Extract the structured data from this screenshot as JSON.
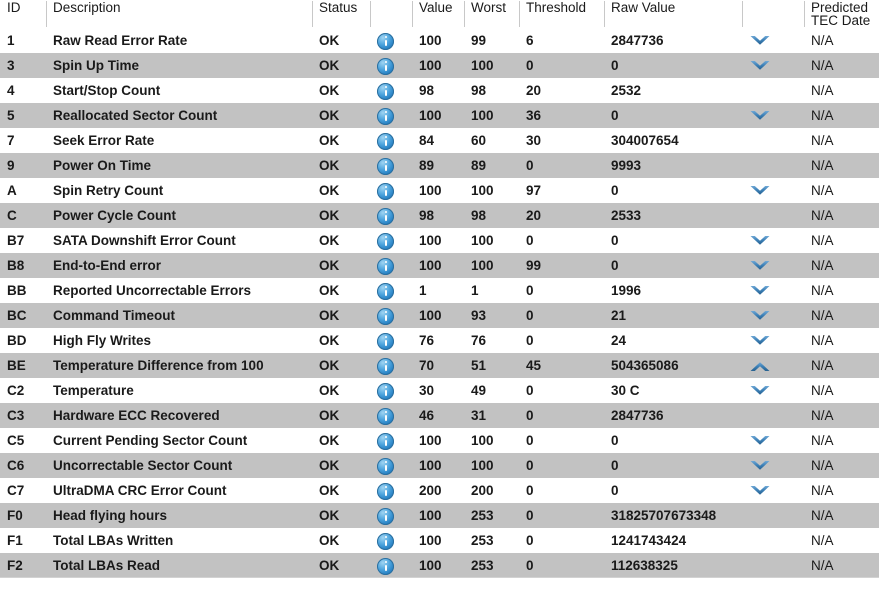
{
  "table": {
    "columns": [
      {
        "key": "id",
        "label": "ID",
        "label2": ""
      },
      {
        "key": "desc",
        "label": "Description",
        "label2": ""
      },
      {
        "key": "status",
        "label": "Status",
        "label2": ""
      },
      {
        "key": "info",
        "label": "",
        "label2": ""
      },
      {
        "key": "value",
        "label": "Value",
        "label2": ""
      },
      {
        "key": "worst",
        "label": "Worst",
        "label2": ""
      },
      {
        "key": "threshold",
        "label": "Threshold",
        "label2": ""
      },
      {
        "key": "raw",
        "label": "Raw Value",
        "label2": ""
      },
      {
        "key": "trend",
        "label": "",
        "label2": ""
      },
      {
        "key": "tec",
        "label": "Predicted",
        "label2": "TEC Date"
      }
    ],
    "icons": {
      "info": "info-icon",
      "trend_down": "chevron-down-icon",
      "trend_up": "chevron-up-icon"
    },
    "colors": {
      "row_even": "#c2c2c2",
      "row_odd": "#ffffff",
      "info_icon_blue": "#1f78bd",
      "chevron_blue": "#2f6fa8",
      "text": "#1a1a1a"
    },
    "rows": [
      {
        "id": "1",
        "desc": "Raw Read Error Rate",
        "status": "OK",
        "value": "100",
        "worst": "99",
        "threshold": "6",
        "raw": "2847736",
        "trend": "down",
        "tec": "N/A"
      },
      {
        "id": "3",
        "desc": "Spin Up Time",
        "status": "OK",
        "value": "100",
        "worst": "100",
        "threshold": "0",
        "raw": "0",
        "trend": "down",
        "tec": "N/A"
      },
      {
        "id": "4",
        "desc": "Start/Stop Count",
        "status": "OK",
        "value": "98",
        "worst": "98",
        "threshold": "20",
        "raw": "2532",
        "trend": "",
        "tec": "N/A"
      },
      {
        "id": "5",
        "desc": "Reallocated Sector Count",
        "status": "OK",
        "value": "100",
        "worst": "100",
        "threshold": "36",
        "raw": "0",
        "trend": "down",
        "tec": "N/A"
      },
      {
        "id": "7",
        "desc": "Seek Error Rate",
        "status": "OK",
        "value": "84",
        "worst": "60",
        "threshold": "30",
        "raw": "304007654",
        "trend": "",
        "tec": "N/A"
      },
      {
        "id": "9",
        "desc": "Power On Time",
        "status": "OK",
        "value": "89",
        "worst": "89",
        "threshold": "0",
        "raw": "9993",
        "trend": "",
        "tec": "N/A"
      },
      {
        "id": "A",
        "desc": "Spin Retry Count",
        "status": "OK",
        "value": "100",
        "worst": "100",
        "threshold": "97",
        "raw": "0",
        "trend": "down",
        "tec": "N/A"
      },
      {
        "id": "C",
        "desc": "Power Cycle Count",
        "status": "OK",
        "value": "98",
        "worst": "98",
        "threshold": "20",
        "raw": "2533",
        "trend": "",
        "tec": "N/A"
      },
      {
        "id": "B7",
        "desc": "SATA Downshift Error Count",
        "status": "OK",
        "value": "100",
        "worst": "100",
        "threshold": "0",
        "raw": "0",
        "trend": "down",
        "tec": "N/A"
      },
      {
        "id": "B8",
        "desc": "End-to-End error",
        "status": "OK",
        "value": "100",
        "worst": "100",
        "threshold": "99",
        "raw": "0",
        "trend": "down",
        "tec": "N/A"
      },
      {
        "id": "BB",
        "desc": "Reported Uncorrectable Errors",
        "status": "OK",
        "value": "1",
        "worst": "1",
        "threshold": "0",
        "raw": "1996",
        "trend": "down",
        "tec": "N/A"
      },
      {
        "id": "BC",
        "desc": "Command Timeout",
        "status": "OK",
        "value": "100",
        "worst": "93",
        "threshold": "0",
        "raw": "21",
        "trend": "down",
        "tec": "N/A"
      },
      {
        "id": "BD",
        "desc": "High Fly Writes",
        "status": "OK",
        "value": "76",
        "worst": "76",
        "threshold": "0",
        "raw": "24",
        "trend": "down",
        "tec": "N/A"
      },
      {
        "id": "BE",
        "desc": "Temperature Difference from 100",
        "status": "OK",
        "value": "70",
        "worst": "51",
        "threshold": "45",
        "raw": "504365086",
        "trend": "up",
        "tec": "N/A"
      },
      {
        "id": "C2",
        "desc": "Temperature",
        "status": "OK",
        "value": "30",
        "worst": "49",
        "threshold": "0",
        "raw": "30 C",
        "trend": "down",
        "tec": "N/A"
      },
      {
        "id": "C3",
        "desc": "Hardware ECC Recovered",
        "status": "OK",
        "value": "46",
        "worst": "31",
        "threshold": "0",
        "raw": "2847736",
        "trend": "",
        "tec": "N/A"
      },
      {
        "id": "C5",
        "desc": "Current Pending Sector Count",
        "status": "OK",
        "value": "100",
        "worst": "100",
        "threshold": "0",
        "raw": "0",
        "trend": "down",
        "tec": "N/A"
      },
      {
        "id": "C6",
        "desc": "Uncorrectable Sector Count",
        "status": "OK",
        "value": "100",
        "worst": "100",
        "threshold": "0",
        "raw": "0",
        "trend": "down",
        "tec": "N/A"
      },
      {
        "id": "C7",
        "desc": "UltraDMA CRC Error Count",
        "status": "OK",
        "value": "200",
        "worst": "200",
        "threshold": "0",
        "raw": "0",
        "trend": "down",
        "tec": "N/A"
      },
      {
        "id": "F0",
        "desc": "Head flying hours",
        "status": "OK",
        "value": "100",
        "worst": "253",
        "threshold": "0",
        "raw": "31825707673348",
        "trend": "",
        "tec": "N/A"
      },
      {
        "id": "F1",
        "desc": "Total LBAs Written",
        "status": "OK",
        "value": "100",
        "worst": "253",
        "threshold": "0",
        "raw": "1241743424",
        "trend": "",
        "tec": "N/A"
      },
      {
        "id": "F2",
        "desc": "Total LBAs Read",
        "status": "OK",
        "value": "100",
        "worst": "253",
        "threshold": "0",
        "raw": "112638325",
        "trend": "",
        "tec": "N/A"
      }
    ]
  }
}
